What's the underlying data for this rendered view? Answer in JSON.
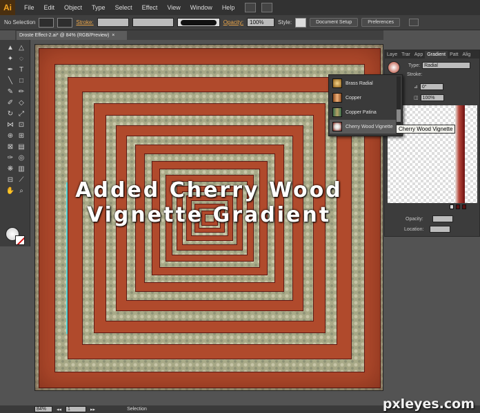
{
  "app": {
    "logo": "Ai"
  },
  "menu": [
    "File",
    "Edit",
    "Object",
    "Type",
    "Select",
    "Effect",
    "View",
    "Window",
    "Help"
  ],
  "control_bar": {
    "selection": "No Selection",
    "stroke_label": "Stroke:",
    "opacity_label": "Opacity:",
    "opacity_value": "100%",
    "style_label": "Style:",
    "document_setup": "Document Setup",
    "preferences": "Preferences"
  },
  "document": {
    "tab_title": "Droste Effect-2.ai* @ 84% (RGB/Preview)",
    "close": "×"
  },
  "canvas": {
    "caption_line1": "Added Cherry Wood",
    "caption_line2": "Vignette Gradient"
  },
  "gradient_panel": {
    "tabs": [
      "Laye",
      "Trar",
      "App",
      "Gradient",
      "Patt",
      "Alig"
    ],
    "type_label": "Type:",
    "type_value": "Radial",
    "stroke_label": "Stroke:",
    "angle_value": "0°",
    "ratio_value": "100%",
    "opacity_label": "Opacity:",
    "location_label": "Location:"
  },
  "swatch_popup": {
    "items": [
      "Brass Radial",
      "Copper",
      "Copper Patina",
      "Cherry Wood Vignette"
    ],
    "selected": "Cherry Wood Vignette",
    "tooltip": "Cherry Wood Vignette"
  },
  "status_bar": {
    "zoom": "84%",
    "artboard": "1",
    "tool": "Selection"
  },
  "watermark": "pxleyes.com",
  "colors": {
    "frame": "#b04a2c",
    "frame_dark": "#5e1612",
    "canvas_bg": "#a9aa88",
    "accent": "#e8a54a"
  }
}
